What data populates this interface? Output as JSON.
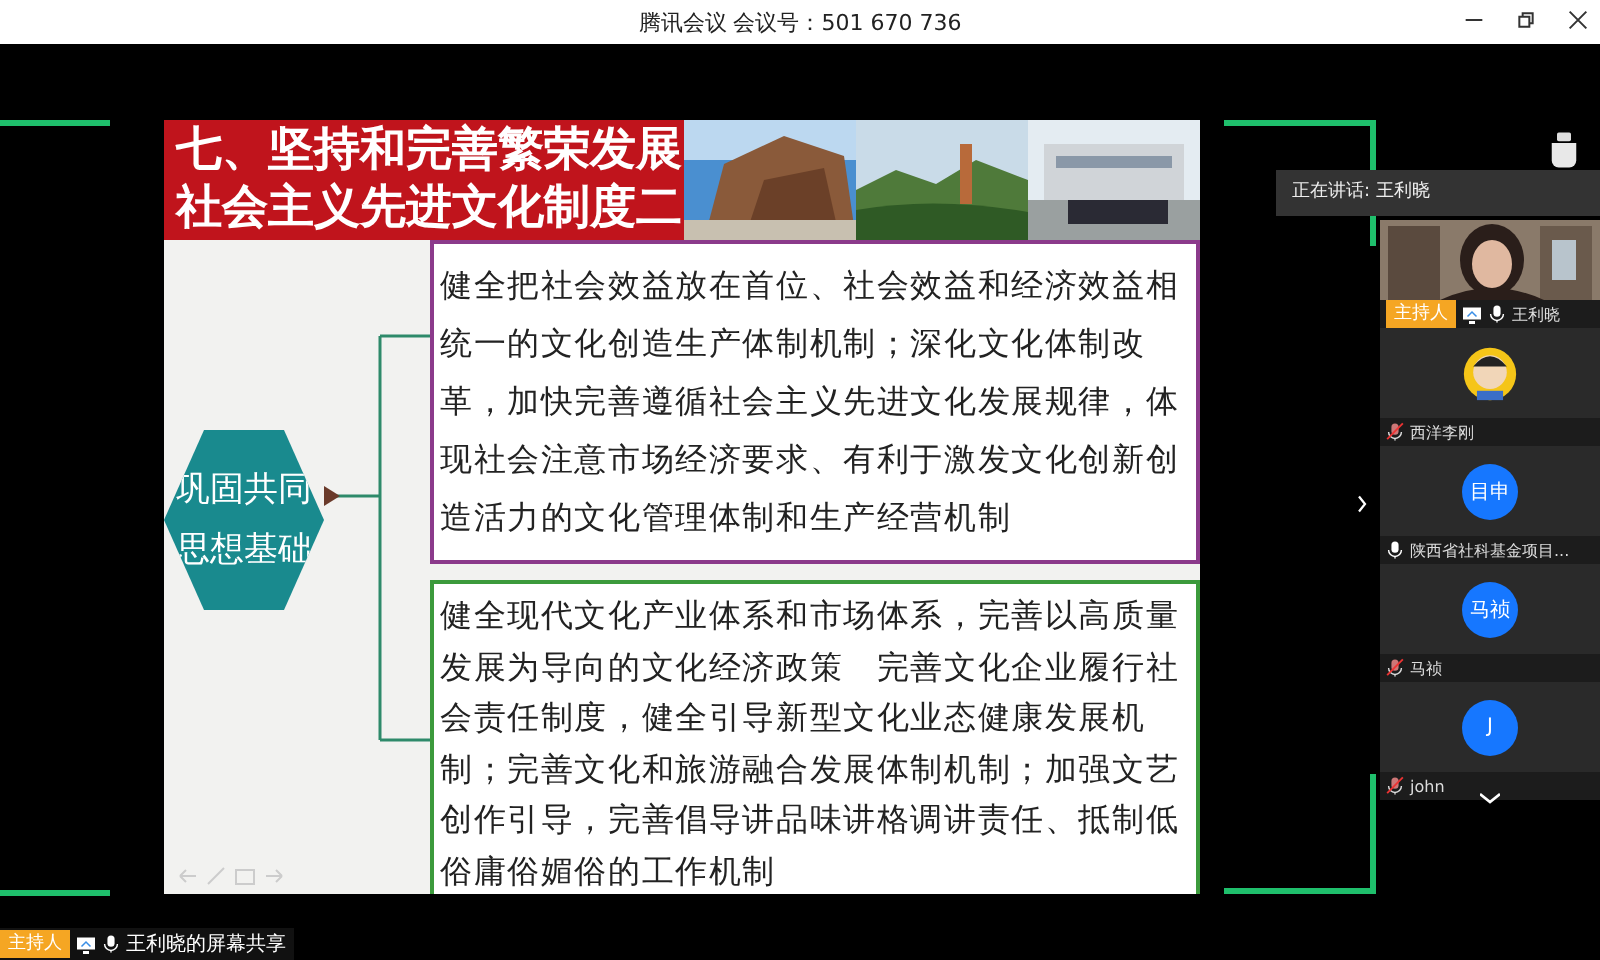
{
  "window": {
    "title": "腾讯会议 会议号：501 670 736"
  },
  "slide": {
    "title_lines": [
      "七、坚持和完善繁荣发展",
      "社会主义先进文化制度二"
    ],
    "topic_lines": [
      "巩固共同",
      "思想基础"
    ],
    "boxes": [
      {
        "color": "#8b3a8b",
        "text": "健全把社会效益放在首位、社会效益和经济效益相统一的文化创造生产体制机制；深化文化体制改革，加快完善遵循社会主义先进文化发展规律，体现社会注意市场经济要求、有利于激发文化创新创造活力的文化管理体制和生产经营机制"
      },
      {
        "color": "#3c9a3c",
        "text": "健全现代文化产业体系和市场体系，完善以高质量发展为导向的文化经济政策　完善文化企业履行社会责任制度，健全引导新型文化业态健康发展机制；完善文化和旅游融合发展体制机制；加强文艺创作引导，完善倡导讲品味讲格调讲责任、抵制低俗庸俗媚俗的工作机制"
      }
    ]
  },
  "speaking": {
    "label": "正在讲话: 王利晓"
  },
  "participants": [
    {
      "kind": "video",
      "name": "王利晓",
      "host_badge": "主持人",
      "sharing": true,
      "muted": false
    },
    {
      "kind": "avatar",
      "name": "西洋李刚",
      "muted": true
    },
    {
      "kind": "initials",
      "initials": "目申",
      "name": "陕西省社科基金项目...",
      "muted": false
    },
    {
      "kind": "initials",
      "initials": "马祯",
      "name": "马祯",
      "muted": true
    },
    {
      "kind": "initials",
      "initials": "J",
      "name": "john",
      "muted": true
    }
  ],
  "share_bar": {
    "host_badge": "主持人",
    "label": "王利晓的屏幕共享",
    "sharing": true,
    "muted": false
  }
}
